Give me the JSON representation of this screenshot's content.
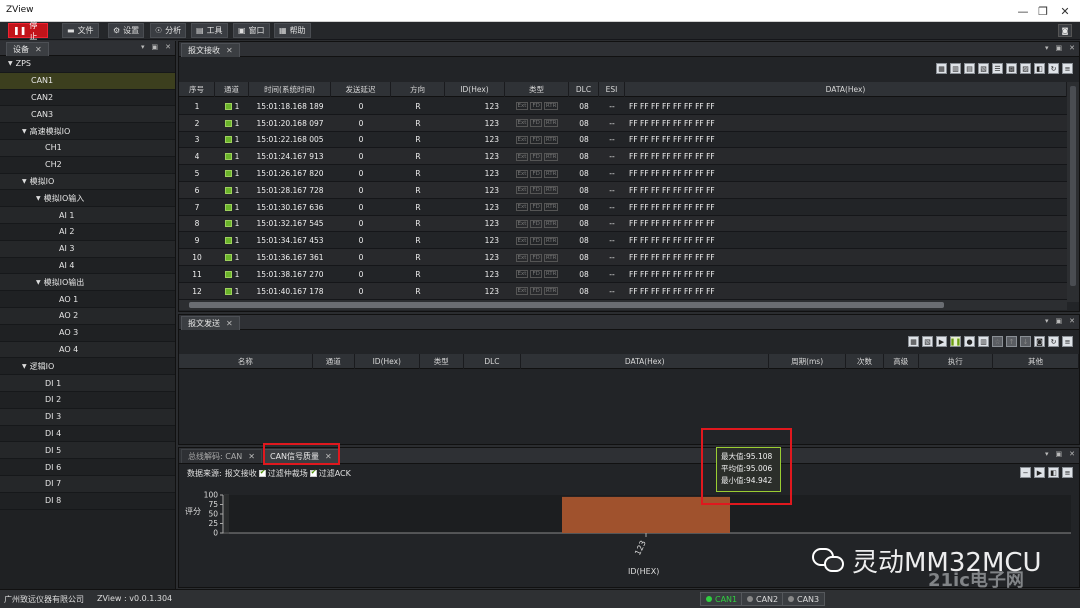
{
  "window": {
    "title": "ZView"
  },
  "toolbar": {
    "stop_label": "停止",
    "items": [
      "文件",
      "设置",
      "分析",
      "工具",
      "窗口",
      "帮助"
    ]
  },
  "device_panel": {
    "tab": "设备",
    "tree": [
      {
        "label": "ZPS",
        "level": 0,
        "expandable": true
      },
      {
        "label": "CAN1",
        "level": 1,
        "selected": true
      },
      {
        "label": "CAN2",
        "level": 1
      },
      {
        "label": "CAN3",
        "level": 1
      },
      {
        "label": "高速模拟IO",
        "level": 1,
        "expandable": true
      },
      {
        "label": "CH1",
        "level": 2
      },
      {
        "label": "CH2",
        "level": 2
      },
      {
        "label": "模拟IO",
        "level": 1,
        "expandable": true
      },
      {
        "label": "模拟IO输入",
        "level": 2,
        "expandable": true
      },
      {
        "label": "AI 1",
        "level": 3
      },
      {
        "label": "AI 2",
        "level": 3
      },
      {
        "label": "AI 3",
        "level": 3
      },
      {
        "label": "AI 4",
        "level": 3
      },
      {
        "label": "模拟IO输出",
        "level": 2,
        "expandable": true
      },
      {
        "label": "AO 1",
        "level": 3
      },
      {
        "label": "AO 2",
        "level": 3
      },
      {
        "label": "AO 3",
        "level": 3
      },
      {
        "label": "AO 4",
        "level": 3
      },
      {
        "label": "逻辑IO",
        "level": 1,
        "expandable": true
      },
      {
        "label": "DI 1",
        "level": 2
      },
      {
        "label": "DI 2",
        "level": 2
      },
      {
        "label": "DI 3",
        "level": 2
      },
      {
        "label": "DI 4",
        "level": 2
      },
      {
        "label": "DI 5",
        "level": 2
      },
      {
        "label": "DI 6",
        "level": 2
      },
      {
        "label": "DI 7",
        "level": 2
      },
      {
        "label": "DI 8",
        "level": 2
      }
    ]
  },
  "receive_panel": {
    "tab": "报文接收",
    "columns": [
      "序号",
      "通道",
      "时间(系统时间)",
      "发送延迟",
      "方向",
      "ID(Hex)",
      "类型",
      "DLC",
      "ESI",
      "DATA(Hex)"
    ],
    "type_flags": [
      "Ext",
      "FD",
      "RTR"
    ],
    "rows": [
      [
        "1",
        "1",
        "15:01:18.168 189",
        "0",
        "R",
        "123",
        "08",
        "--",
        "FF FF FF FF FF FF FF FF"
      ],
      [
        "2",
        "1",
        "15:01:20.168 097",
        "0",
        "R",
        "123",
        "08",
        "--",
        "FF FF FF FF FF FF FF FF"
      ],
      [
        "3",
        "1",
        "15:01:22.168 005",
        "0",
        "R",
        "123",
        "08",
        "--",
        "FF FF FF FF FF FF FF FF"
      ],
      [
        "4",
        "1",
        "15:01:24.167 913",
        "0",
        "R",
        "123",
        "08",
        "--",
        "FF FF FF FF FF FF FF FF"
      ],
      [
        "5",
        "1",
        "15:01:26.167 820",
        "0",
        "R",
        "123",
        "08",
        "--",
        "FF FF FF FF FF FF FF FF"
      ],
      [
        "6",
        "1",
        "15:01:28.167 728",
        "0",
        "R",
        "123",
        "08",
        "--",
        "FF FF FF FF FF FF FF FF"
      ],
      [
        "7",
        "1",
        "15:01:30.167 636",
        "0",
        "R",
        "123",
        "08",
        "--",
        "FF FF FF FF FF FF FF FF"
      ],
      [
        "8",
        "1",
        "15:01:32.167 545",
        "0",
        "R",
        "123",
        "08",
        "--",
        "FF FF FF FF FF FF FF FF"
      ],
      [
        "9",
        "1",
        "15:01:34.167 453",
        "0",
        "R",
        "123",
        "08",
        "--",
        "FF FF FF FF FF FF FF FF"
      ],
      [
        "10",
        "1",
        "15:01:36.167 361",
        "0",
        "R",
        "123",
        "08",
        "--",
        "FF FF FF FF FF FF FF FF"
      ],
      [
        "11",
        "1",
        "15:01:38.167 270",
        "0",
        "R",
        "123",
        "08",
        "--",
        "FF FF FF FF FF FF FF FF"
      ],
      [
        "12",
        "1",
        "15:01:40.167 178",
        "0",
        "R",
        "123",
        "08",
        "--",
        "FF FF FF FF FF FF FF FF"
      ]
    ]
  },
  "send_panel": {
    "tab": "报文发送",
    "columns": [
      "名称",
      "通道",
      "ID(Hex)",
      "类型",
      "DLC",
      "DATA(Hex)",
      "周期(ms)",
      "次数",
      "高级",
      "执行",
      "其他"
    ]
  },
  "quality_panel": {
    "tabs": [
      "总线解码: CAN",
      "CAN信号质量"
    ],
    "source_label": "数据来源:",
    "source_value": "报文接收",
    "filter1": "过滤仲裁场",
    "filter2": "过滤ACK",
    "tooltip": [
      "最大值:95.108",
      "平均值:95.006",
      "最小值:94.942"
    ]
  },
  "chart_data": {
    "type": "bar",
    "categories": [
      "123"
    ],
    "values": [
      95.006
    ],
    "xlabel": "ID(HEX)",
    "ylabel": "评分",
    "ylim": [
      0,
      100
    ],
    "yticks": [
      "100",
      "75",
      "50",
      "25",
      "0"
    ],
    "bar_color": "#a0522d"
  },
  "statusbar": {
    "company": "广州致远仪器有限公司",
    "version": "ZView : v0.0.1.304",
    "channels": [
      "CAN1",
      "CAN2",
      "CAN3"
    ]
  },
  "watermark": {
    "text": "灵动MM32MCU",
    "site": "21ic电子网"
  },
  "colors": {
    "stop": "#c2141a",
    "accent_green": "#6ab42a",
    "bar": "#a0522d",
    "highlight_red": "#e0181e"
  }
}
